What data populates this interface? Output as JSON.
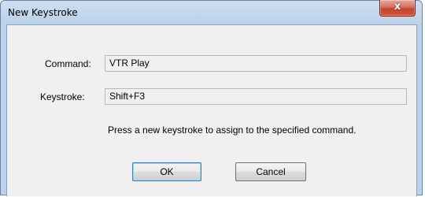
{
  "window": {
    "title": "New Keystroke"
  },
  "titlebar": {
    "close_glyph": "x"
  },
  "form": {
    "command_label": "Command:",
    "command_value": "VTR Play",
    "keystroke_label": "Keystroke:",
    "keystroke_value": "Shift+F3",
    "hint": "Press a new keystroke to assign to the specified command."
  },
  "buttons": {
    "ok": "OK",
    "cancel": "Cancel"
  },
  "colors": {
    "titlebar": "#b9d1ea",
    "close_button": "#c4442c",
    "client_bg": "#f0f0f0"
  }
}
